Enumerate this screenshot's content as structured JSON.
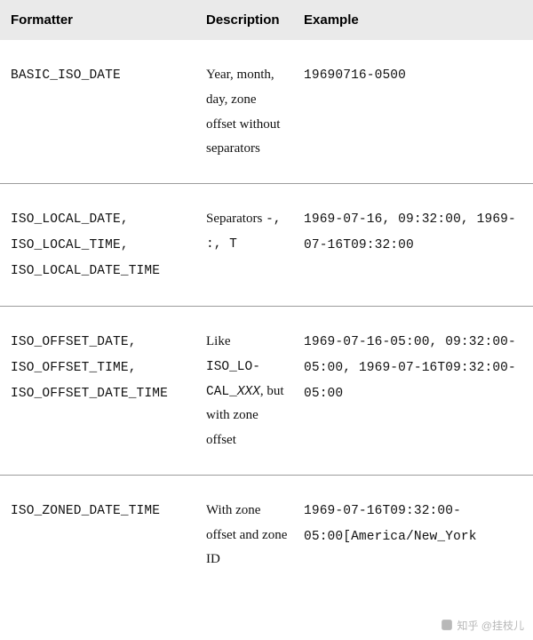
{
  "table": {
    "headers": {
      "formatter": "Formatter",
      "description": "Description",
      "example": "Example"
    },
    "rows": [
      {
        "formatter": "BASIC_ISO_DATE",
        "description": "Year, month, day, zone offset without separators",
        "example": "19690716-0500"
      },
      {
        "formatter": "ISO_LOCAL_DATE, ISO_LOCAL_TIME, ISO_LOCAL_DATE_TIME",
        "description_pre": "Separators ",
        "description_mono": "-, :, T",
        "example": "1969-07-16, 09:32:00, 1969-07-16T09:32:00"
      },
      {
        "formatter": "ISO_OFFSET_DATE, ISO_OFFSET_TIME, ISO_OFFSET_DATE_TIME",
        "description_pre": "Like ",
        "description_mono": "ISO_LO­CAL_",
        "description_monoi": "XXX",
        "description_post": ", but with zone offset",
        "example": "1969-07-16-05:00, 09:32:00-05:00, 1969-07-16T09:32:00-05:00"
      },
      {
        "formatter": "ISO_ZONED_DATE_TIME",
        "description": "With zone offset and zone ID",
        "example": "1969-07-16T09:32:00-05:00[America/New_York"
      }
    ]
  },
  "watermark": "知乎 @挂枝儿"
}
